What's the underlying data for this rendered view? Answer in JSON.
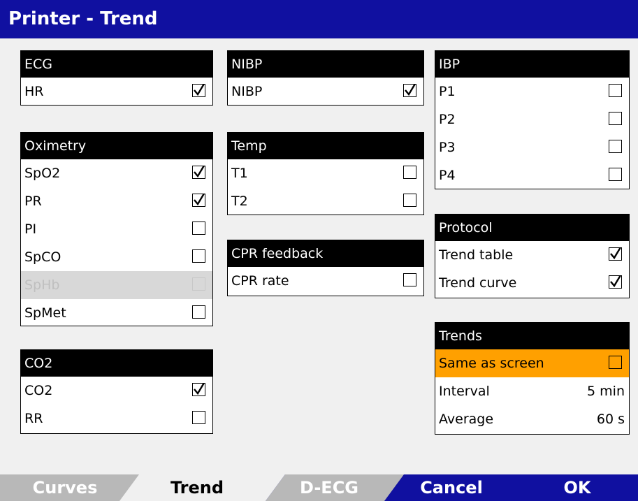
{
  "title": "Printer - Trend",
  "groups": {
    "ecg": {
      "header": "ECG",
      "rows": [
        {
          "label": "HR",
          "checked": true
        }
      ]
    },
    "nibp": {
      "header": "NIBP",
      "rows": [
        {
          "label": "NIBP",
          "checked": true
        }
      ]
    },
    "ibp": {
      "header": "IBP",
      "rows": [
        {
          "label": "P1",
          "checked": false
        },
        {
          "label": "P2",
          "checked": false
        },
        {
          "label": "P3",
          "checked": false
        },
        {
          "label": "P4",
          "checked": false
        }
      ]
    },
    "oximetry": {
      "header": "Oximetry",
      "rows": [
        {
          "label": "SpO2",
          "checked": true
        },
        {
          "label": "PR",
          "checked": true
        },
        {
          "label": "PI",
          "checked": false
        },
        {
          "label": "SpCO",
          "checked": false
        },
        {
          "label": "SpHb",
          "checked": false,
          "disabled": true
        },
        {
          "label": "SpMet",
          "checked": false
        }
      ]
    },
    "temp": {
      "header": "Temp",
      "rows": [
        {
          "label": "T1",
          "checked": false
        },
        {
          "label": "T2",
          "checked": false
        }
      ]
    },
    "cpr": {
      "header": "CPR feedback",
      "rows": [
        {
          "label": "CPR rate",
          "checked": false
        }
      ]
    },
    "protocol": {
      "header": "Protocol",
      "rows": [
        {
          "label": "Trend table",
          "checked": true
        },
        {
          "label": "Trend curve",
          "checked": true
        }
      ]
    },
    "co2": {
      "header": "CO2",
      "rows": [
        {
          "label": "CO2",
          "checked": true
        },
        {
          "label": "RR",
          "checked": false
        }
      ]
    },
    "trends": {
      "header": "Trends",
      "same_as_screen": {
        "label": "Same as screen",
        "checked": false
      },
      "interval": {
        "label": "Interval",
        "value": "5 min"
      },
      "average": {
        "label": "Average",
        "value": "60 s"
      }
    }
  },
  "tabs": {
    "curves": "Curves",
    "trend": "Trend",
    "decg": "D-ECG",
    "cancel": "Cancel",
    "ok": "OK"
  },
  "colors": {
    "title_bar": "#1010a0",
    "highlight": "#ffa000",
    "tab_inactive": "#b8b8b8",
    "tab_active": "#f0f0f0"
  }
}
